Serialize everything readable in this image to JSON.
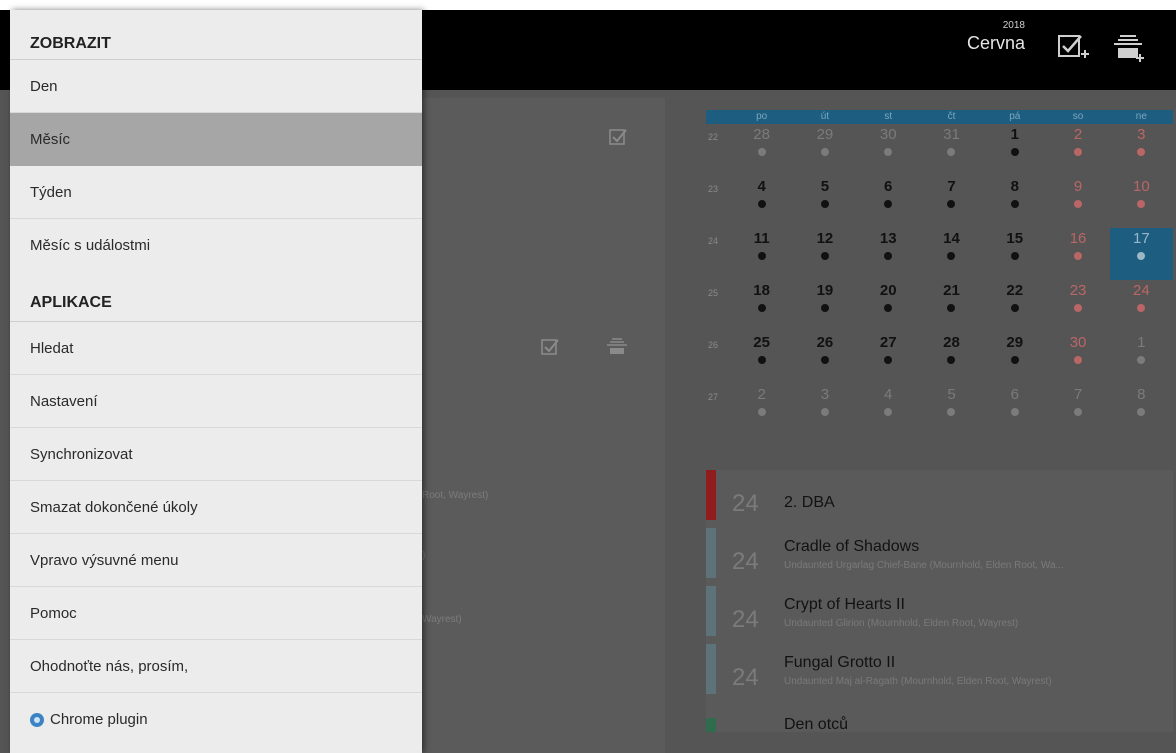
{
  "header": {
    "year": "2018",
    "month": "Cervna",
    "icons": [
      "task-add-icon",
      "event-add-icon"
    ]
  },
  "drawer": {
    "view_section": "ZOBRAZIT",
    "view_items": [
      "Den",
      "Měsíc",
      "Týden",
      "Měsíc s událostmi"
    ],
    "active_item": "Měsíc",
    "app_section": "APLIKACE",
    "app_items": [
      "Hledat",
      "Nastavení",
      "Synchronizovat",
      "Smazat dokončené úkoly",
      "Vpravo výsuvné menu",
      "Pomoc",
      "Ohodnoťte nás, prosím,",
      "Chrome plugin"
    ]
  },
  "peek": {
    "text1": "Root, Wayrest)",
    "text2": ")",
    "text3": "Wayrest)"
  },
  "calendar": {
    "weekdays": [
      "po",
      "út",
      "st",
      "čt",
      "pá",
      "so",
      "ne"
    ],
    "weeks": [
      {
        "num": "22",
        "days": [
          "28",
          "29",
          "30",
          "31",
          "1",
          "2",
          "3"
        ]
      },
      {
        "num": "23",
        "days": [
          "4",
          "5",
          "6",
          "7",
          "8",
          "9",
          "10"
        ]
      },
      {
        "num": "24",
        "days": [
          "11",
          "12",
          "13",
          "14",
          "15",
          "16",
          "17"
        ]
      },
      {
        "num": "25",
        "days": [
          "18",
          "19",
          "20",
          "21",
          "22",
          "23",
          "24"
        ]
      },
      {
        "num": "26",
        "days": [
          "25",
          "26",
          "27",
          "28",
          "29",
          "30",
          "1"
        ]
      },
      {
        "num": "27",
        "days": [
          "2",
          "3",
          "4",
          "5",
          "6",
          "7",
          "8"
        ]
      }
    ],
    "today": "17"
  },
  "events": [
    {
      "day": "24",
      "title": "2. DBA",
      "sub": "",
      "color": "#8f1d1d"
    },
    {
      "day": "24",
      "title": "Cradle of Shadows",
      "sub": "Undaunted Urgarlag Chief-Bane (Mournhold, Elden Root, Wa...",
      "color": "#5e7379"
    },
    {
      "day": "24",
      "title": "Crypt of Hearts II",
      "sub": "Undaunted Glirion (Mournhold, Elden Root, Wayrest)",
      "color": "#5e7379"
    },
    {
      "day": "24",
      "title": "Fungal Grotto II",
      "sub": "Undaunted Maj al-Ragath (Mournhold, Elden Root, Wayrest)",
      "color": "#5e7379"
    },
    {
      "day": "",
      "title": "Den otců",
      "sub": "",
      "color": "#2f6b4d"
    }
  ]
}
